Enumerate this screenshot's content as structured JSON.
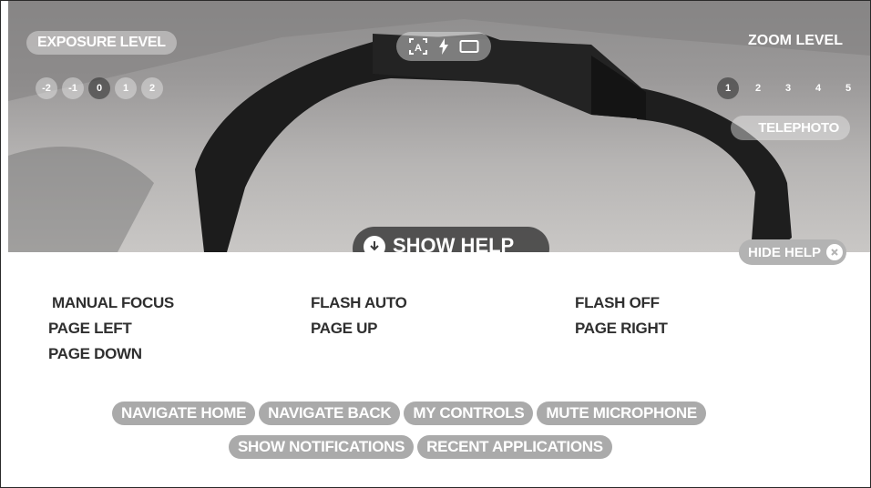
{
  "viewfinder": {
    "exposure": {
      "label": "EXPOSURE LEVEL",
      "levels": [
        "-2",
        "-1",
        "0",
        "1",
        "2"
      ],
      "selected": "0"
    },
    "zoom": {
      "label": "ZOOM LEVEL",
      "levels": [
        "1",
        "2",
        "3",
        "4",
        "5"
      ],
      "selected": "1",
      "mode_label": "TELEPHOTO"
    },
    "mode_icons": [
      "auto-focus-icon",
      "flash-icon",
      "aspect-ratio-icon"
    ],
    "show_help_label": "SHOW HELP",
    "hide_help_label": "HIDE HELP"
  },
  "help": {
    "commands": [
      [
        "MANUAL FOCUS",
        "FLASH AUTO",
        "FLASH OFF"
      ],
      [
        "PAGE LEFT",
        "PAGE UP",
        "PAGE RIGHT"
      ],
      [
        "PAGE DOWN"
      ]
    ],
    "global_commands_row1": [
      "NAVIGATE HOME",
      "NAVIGATE BACK",
      "MY CONTROLS",
      "MUTE MICROPHONE"
    ],
    "global_commands_row2": [
      "SHOW NOTIFICATIONS",
      "RECENT APPLICATIONS"
    ]
  },
  "colors": {
    "chip_bg": "#aaaaaa",
    "text_dark": "#2f2f2f",
    "overlay_pill": "rgba(235,235,235,0.45)"
  }
}
